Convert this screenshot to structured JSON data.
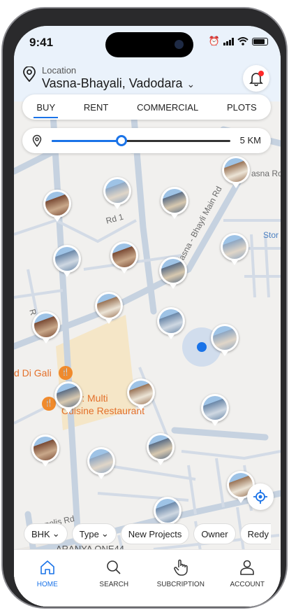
{
  "status": {
    "time": "9:41"
  },
  "location": {
    "caption": "Location",
    "value": "Vasna-Bhayali, Vadodara"
  },
  "tabs": [
    {
      "label": "BUY",
      "active": true
    },
    {
      "label": "RENT",
      "active": false
    },
    {
      "label": "COMMERCIAL",
      "active": false
    },
    {
      "label": "PLOTS",
      "active": false
    }
  ],
  "radius": {
    "value": "5 KM",
    "fraction": 0.39
  },
  "map": {
    "labels": {
      "rd1": "Rd 1",
      "bhayli_main": "Vasna - Bhayli Main Rd",
      "vasna_ro": "asna Ro",
      "stor": "Stor",
      "rd_left": "R",
      "metropolis": "polis Rd",
      "d_gali": "d Di Gali",
      "restaurant_1": "pers: Multi",
      "restaurant_2": "Cuisine Restaurant",
      "aranya": "ARANYA ONE44"
    },
    "marker_count": 20
  },
  "filters": [
    {
      "label": "BHK",
      "dropdown": true
    },
    {
      "label": "Type",
      "dropdown": true
    },
    {
      "label": "New Projects",
      "dropdown": false
    },
    {
      "label": "Owner",
      "dropdown": false
    },
    {
      "label": "Redy to",
      "dropdown": false
    }
  ],
  "nav": [
    {
      "label": "HOME",
      "icon": "home-icon",
      "active": true
    },
    {
      "label": "SEARCH",
      "icon": "search-icon",
      "active": false
    },
    {
      "label": "SUBCRIPTION",
      "icon": "hand-pointer-icon",
      "active": false
    },
    {
      "label": "ACCOUNT",
      "icon": "user-icon",
      "active": false
    }
  ],
  "colors": {
    "accent": "#1a73e8",
    "header_bg": "#eaf2fb",
    "poi": "#e3702a",
    "map_bg": "#f1f0ee"
  }
}
